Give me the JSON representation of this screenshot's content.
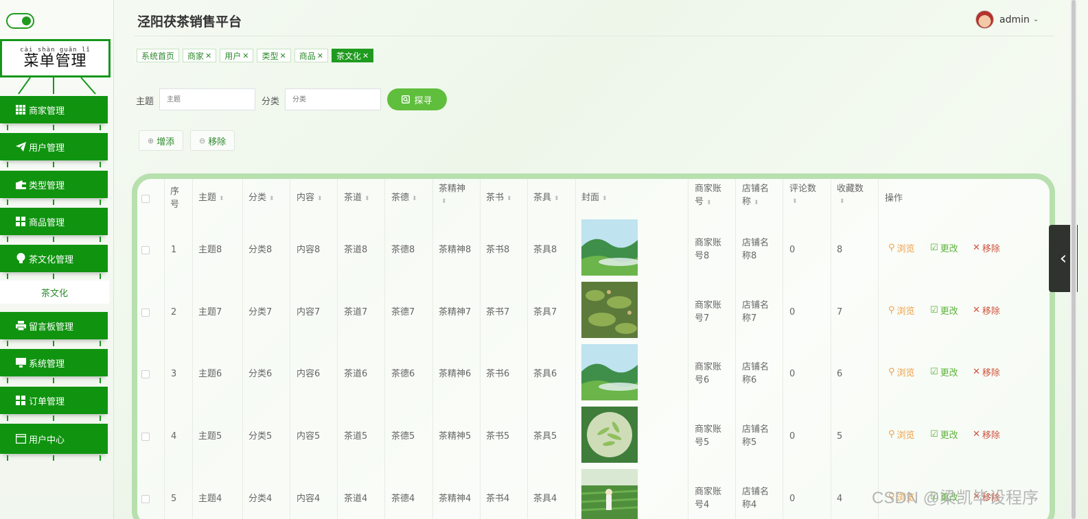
{
  "app_title": "泾阳茯茶销售平台",
  "user": {
    "name": "admin"
  },
  "sidebar": {
    "title_pinyin": "cài shàn guǎn lǐ",
    "title": "菜单管理",
    "items": [
      {
        "label": "商家管理",
        "icon": "grid-icon"
      },
      {
        "label": "用户管理",
        "icon": "paper-plane-icon"
      },
      {
        "label": "类型管理",
        "icon": "wallet-icon"
      },
      {
        "label": "商品管理",
        "icon": "grid-icon"
      },
      {
        "label": "茶文化管理",
        "icon": "lightbulb-icon"
      },
      {
        "label": "留言板管理",
        "icon": "printer-icon"
      },
      {
        "label": "系统管理",
        "icon": "monitor-icon"
      },
      {
        "label": "订单管理",
        "icon": "grid-icon"
      },
      {
        "label": "用户中心",
        "icon": "window-icon"
      }
    ],
    "sub_item": "茶文化"
  },
  "tags": [
    {
      "label": "系统首页",
      "closable": false,
      "active": false
    },
    {
      "label": "商家",
      "closable": true,
      "active": false
    },
    {
      "label": "用户",
      "closable": true,
      "active": false
    },
    {
      "label": "类型",
      "closable": true,
      "active": false
    },
    {
      "label": "商品",
      "closable": true,
      "active": false
    },
    {
      "label": "茶文化",
      "closable": true,
      "active": true
    }
  ],
  "search": {
    "subject_label": "主题",
    "subject_placeholder": "主题",
    "category_label": "分类",
    "category_placeholder": "分类",
    "button": "探寻"
  },
  "actions": {
    "add": "增添",
    "remove": "移除"
  },
  "table": {
    "headers": {
      "index": [
        "序",
        "号"
      ],
      "subject": "主题",
      "category": "分类",
      "content": "内容",
      "tea_way": "茶道",
      "tea_virtue": "茶德",
      "tea_spirit": "茶精神",
      "tea_book": "茶书",
      "tea_ware": "茶具",
      "cover": "封面",
      "merchant_account": [
        "商家账",
        "号"
      ],
      "shop_name": [
        "店铺名",
        "称"
      ],
      "comments": "评论数",
      "favorites": "收藏数",
      "operations": "操作"
    },
    "op_labels": {
      "view": "浏览",
      "edit": "更改",
      "delete": "移除"
    },
    "rows": [
      {
        "index": "1",
        "subject": "主题8",
        "category": "分类8",
        "content": "内容8",
        "tea_way": "茶道8",
        "tea_virtue": "茶德8",
        "tea_spirit": "茶精神8",
        "tea_book": "茶书8",
        "tea_ware": "茶具8",
        "merchant": [
          "商家账",
          "号8"
        ],
        "shop": [
          "店铺名",
          "称8"
        ],
        "comments": "0",
        "favorites": "8",
        "cover": "mountain-mist"
      },
      {
        "index": "2",
        "subject": "主题7",
        "category": "分类7",
        "content": "内容7",
        "tea_way": "茶道7",
        "tea_virtue": "茶德7",
        "tea_spirit": "茶精神7",
        "tea_book": "茶书7",
        "tea_ware": "茶具7",
        "merchant": [
          "商家账",
          "号7"
        ],
        "shop": [
          "店铺名",
          "称7"
        ],
        "comments": "0",
        "favorites": "7",
        "cover": "tea-terraces"
      },
      {
        "index": "3",
        "subject": "主题6",
        "category": "分类6",
        "content": "内容6",
        "tea_way": "茶道6",
        "tea_virtue": "茶德6",
        "tea_spirit": "茶精神6",
        "tea_book": "茶书6",
        "tea_ware": "茶具6",
        "merchant": [
          "商家账",
          "号6"
        ],
        "shop": [
          "店铺名",
          "称6"
        ],
        "comments": "0",
        "favorites": "6",
        "cover": "mountain-mist"
      },
      {
        "index": "4",
        "subject": "主题5",
        "category": "分类5",
        "content": "内容5",
        "tea_way": "茶道5",
        "tea_virtue": "茶德5",
        "tea_spirit": "茶精神5",
        "tea_book": "茶书5",
        "tea_ware": "茶具5",
        "merchant": [
          "商家账",
          "号5"
        ],
        "shop": [
          "店铺名",
          "称5"
        ],
        "comments": "0",
        "favorites": "5",
        "cover": "tea-leaves-bowl"
      },
      {
        "index": "5",
        "subject": "主题4",
        "category": "分类4",
        "content": "内容4",
        "tea_way": "茶道4",
        "tea_virtue": "茶德4",
        "tea_spirit": "茶精神4",
        "tea_book": "茶书4",
        "tea_ware": "茶具4",
        "merchant": [
          "商家账",
          "号4"
        ],
        "shop": [
          "店铺名",
          "称4"
        ],
        "comments": "0",
        "favorites": "4",
        "cover": "tea-field-picker"
      }
    ]
  },
  "watermark": "CSDN @梁凯毕设程序",
  "colors": {
    "primary": "#109410",
    "accent": "#5fbe3c",
    "view": "#f0a048",
    "edit": "#5cb23a",
    "delete": "#d0523c"
  }
}
